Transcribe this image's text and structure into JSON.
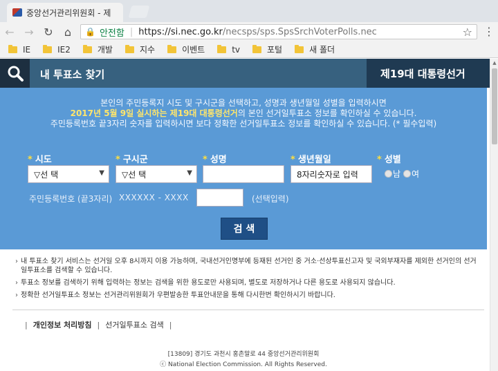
{
  "browser": {
    "tab_title": "중앙선거관리위원회 - 제",
    "secure_label": "안전함",
    "url_host": "https://si.nec.go.kr",
    "url_path": "/necsps/sps.SpsSrchVoterPolls.nec",
    "bookmarks": [
      "IE",
      "IE2",
      "개발",
      "지수",
      "이벤트",
      "tv",
      "포털",
      "새 폴더"
    ]
  },
  "header": {
    "title": "내 투표소 찾기",
    "election": "제19대 대통령선거"
  },
  "intro": {
    "line1": "본인의 주민등록지 시도 및 구시군을 선택하고, 성명과 생년월일 성별을 입력하시면",
    "line2_highlight": "2017년 5월 9일 실시하는 제19대 대통령선거",
    "line2_rest": "의 본인 선거일투표소 정보를 확인하실 수 있습니다.",
    "line3": "주민등록번호 끝3자리 숫자를 입력하시면 보다 정확한 선거일투표소 정보를 확인하실 수 있습니다. (* 필수입력)"
  },
  "form": {
    "required_mark": "*",
    "sido_label": "시도",
    "sido_value": "▽선 택",
    "gusigun_label": "구시군",
    "gusigun_value": "▽선 택",
    "name_label": "성명",
    "name_value": "",
    "birth_label": "생년월일",
    "birth_value": "8자리숫자로 입력",
    "gender_label": "성별",
    "gender_male": "남",
    "gender_female": "여",
    "rrn_label": "주민등록번호 (끝3자리)",
    "rrn_mask": "XXXXXX - XXXX",
    "rrn_value": "",
    "optional_note": "(선택입력)",
    "search_button": "검 색"
  },
  "notices": [
    "내 투표소 찾기 서비스는 선거일 오후 8시까지 이용 가능하며, 국내선거인명부에 등재된 선거인 중 거소·선상투표신고자 및 국외부재자를 제외한 선거인의 선거일투표소를 검색할 수 있습니다.",
    "투표소 정보를 검색하기 위해 입력하는 정보는 검색을 위한 용도로만 사용되며, 별도로 저장하거나 다른 용도로 사용되지 않습니다.",
    "정확한 선거일투표소 정보는 선거관리위원회가 우편발송한 투표안내문을 통해 다시한번 확인하시기 바랍니다."
  ],
  "footer": {
    "privacy_link": "개인정보 처리방침",
    "search_link": "선거일투표소 검색",
    "address": "[13809] 경기도 과천시 홍촌말로 44 중앙선거관리위원회",
    "copyright": "ⓒ National Election Commission. All Rights Reserved."
  }
}
